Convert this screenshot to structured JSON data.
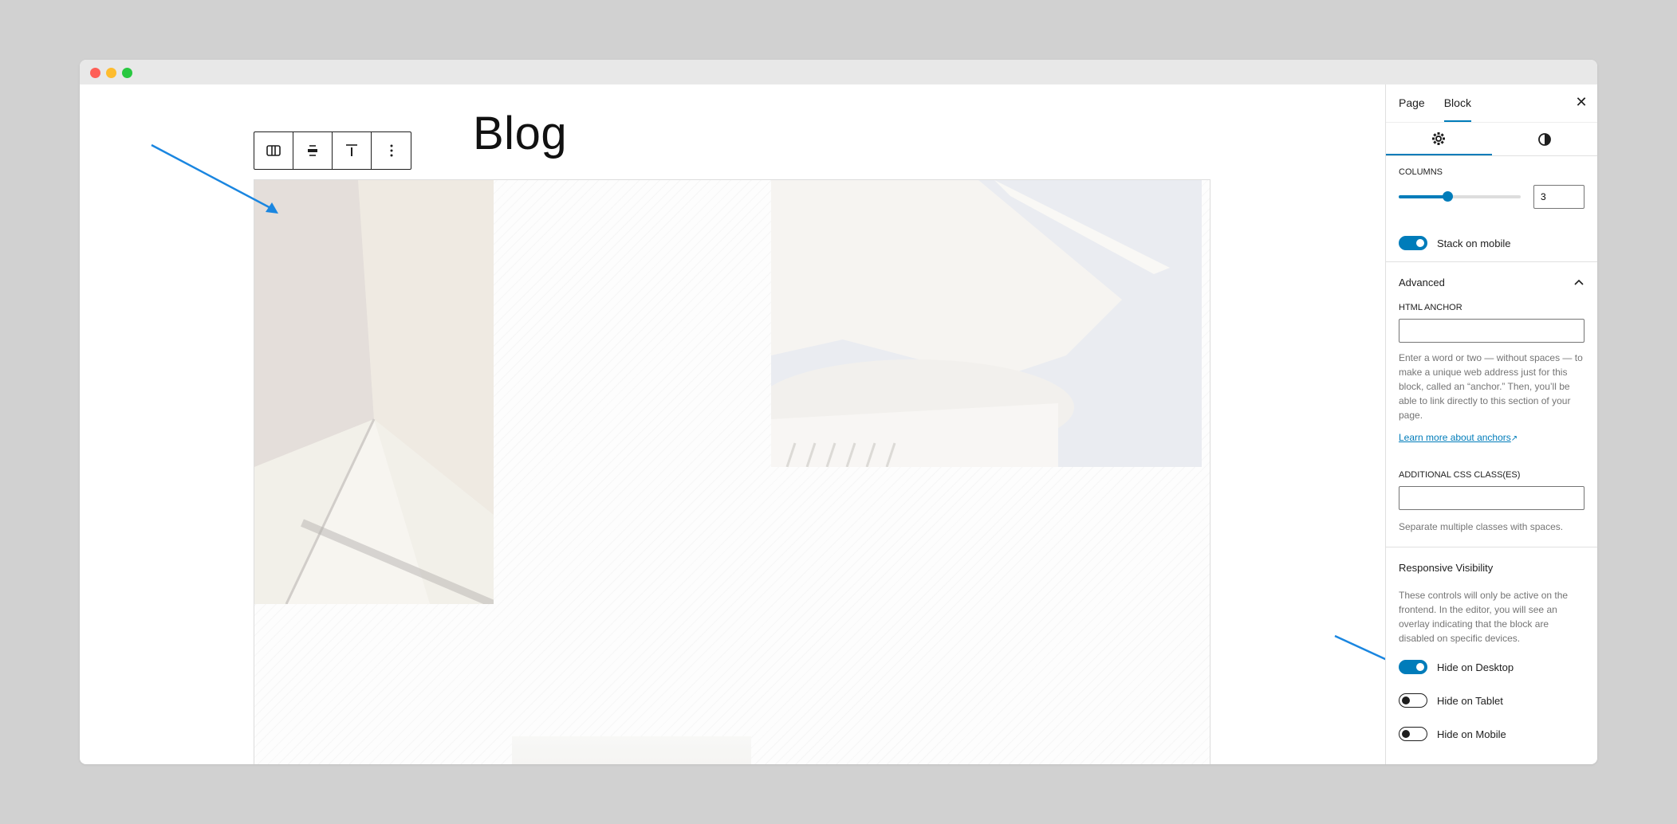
{
  "page": {
    "title": "Blog"
  },
  "toolbar": {
    "buttons": [
      {
        "name": "columns-icon"
      },
      {
        "name": "align-icon"
      },
      {
        "name": "vertical-align-icon"
      },
      {
        "name": "more-options-icon"
      }
    ]
  },
  "sidebar": {
    "tabs": [
      {
        "label": "Page",
        "active": false
      },
      {
        "label": "Block",
        "active": true
      }
    ],
    "close_icon": "close-icon",
    "settings_tab_icon": "gear-icon",
    "styles_tab_icon": "contrast-icon",
    "columns": {
      "label": "COLUMNS",
      "value": "3",
      "fraction": 0.4
    },
    "stack_on_mobile": {
      "label": "Stack on mobile",
      "on": true
    },
    "advanced": {
      "title": "Advanced",
      "expanded": true,
      "html_anchor": {
        "label": "HTML ANCHOR",
        "value": "",
        "help": "Enter a word or two — without spaces — to make a unique web address just for this block, called an “anchor.” Then, you’ll be able to link directly to this section of your page.",
        "link": "Learn more about anchors"
      },
      "css_classes": {
        "label": "ADDITIONAL CSS CLASS(ES)",
        "value": "",
        "help": "Separate multiple classes with spaces."
      }
    },
    "responsive": {
      "title": "Responsive Visibility",
      "help": "These controls will only be active on the frontend. In the editor, you will see an overlay indicating that the block are disabled on specific devices.",
      "toggles": [
        {
          "label": "Hide on Desktop",
          "on": true
        },
        {
          "label": "Hide on Tablet",
          "on": false
        },
        {
          "label": "Hide on Mobile",
          "on": false
        }
      ]
    }
  },
  "colors": {
    "accent": "#007cba",
    "arrow": "#1a86e0"
  }
}
